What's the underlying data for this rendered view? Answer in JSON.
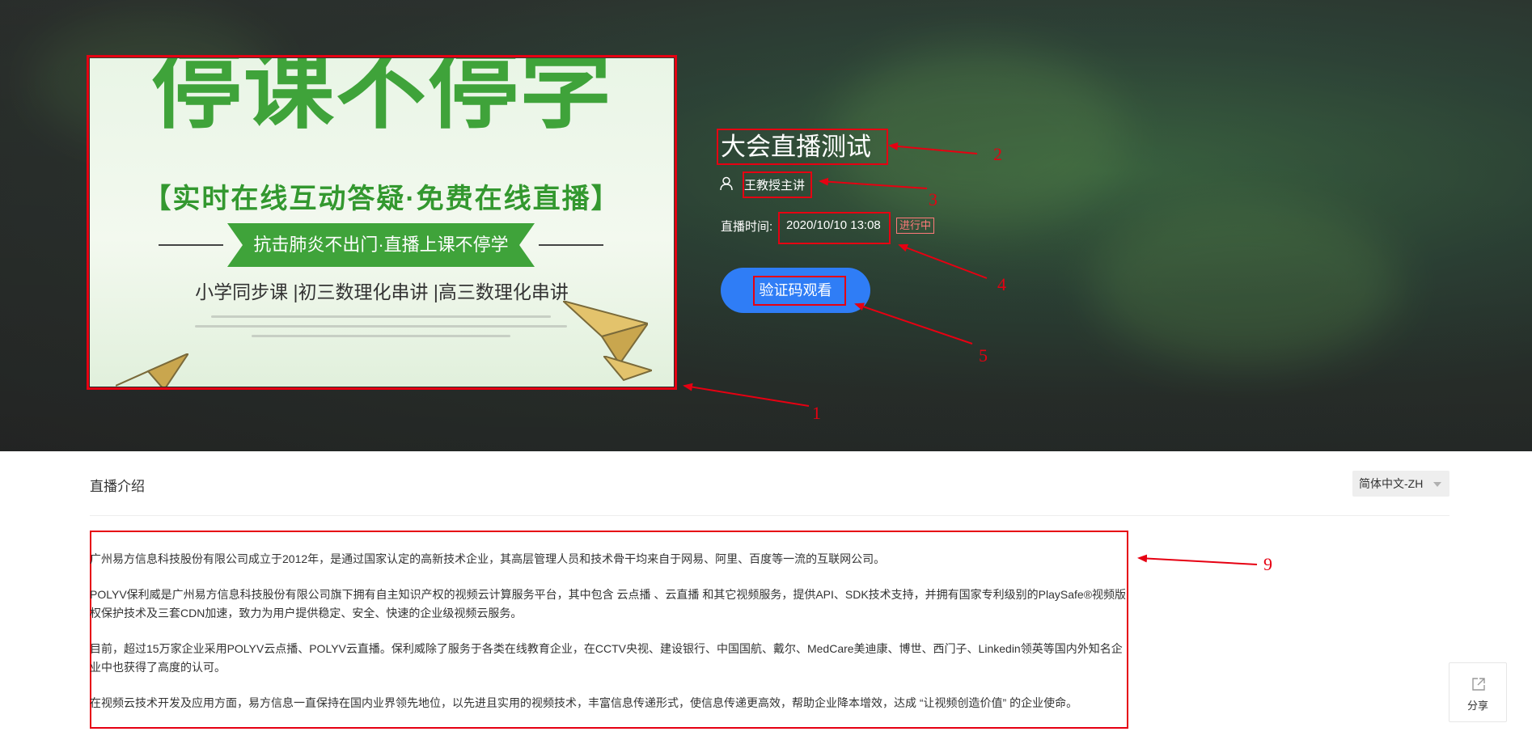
{
  "hero": {
    "cover": {
      "headline": "停课不停学",
      "subtitle": "【实时在线互动答疑·免费在线直播】",
      "ribbon": "抗击肺炎不出门·直播上课不停学",
      "courses": "小学同步课 |初三数理化串讲 |高三数理化串讲"
    },
    "title": "大会直播测试",
    "host": "王教授主讲",
    "time_label": "直播时间:",
    "time_value": "2020/10/10 13:08",
    "status": "进行中",
    "watch_button": "验证码观看",
    "icons": {
      "host": "user-icon"
    }
  },
  "intro": {
    "title": "直播介绍",
    "language_select": "简体中文-ZH",
    "paragraphs": [
      "广州易方信息科技股份有限公司成立于2012年，是通过国家认定的高新技术企业，其高层管理人员和技术骨干均来自于网易、阿里、百度等一流的互联网公司。",
      "POLYV保利威是广州易方信息科技股份有限公司旗下拥有自主知识产权的视频云计算服务平台，其中包含 云点播 、云直播 和其它视频服务，提供API、SDK技术支持，并拥有国家专利级别的PlaySafe®视频版权保护技术及三套CDN加速，致力为用户提供稳定、安全、快速的企业级视频云服务。",
      "目前，超过15万家企业采用POLYV云点播、POLYV云直播。保利威除了服务于各类在线教育企业，在CCTV央视、建设银行、中国国航、戴尔、MedCare美迪康、博世、西门子、Linkedin领英等国内外知名企业中也获得了高度的认可。",
      "在视频云技术开发及应用方面，易方信息一直保持在国内业界领先地位，以先进且实用的视频技术，丰富信息传递形式，使信息传递更高效，帮助企业降本增效，达成 “让视频创造价值” 的企业使命。"
    ]
  },
  "share": {
    "label": "分享",
    "icon": "share-icon"
  },
  "annotations": [
    "1",
    "2",
    "3",
    "4",
    "5",
    "9"
  ],
  "colors": {
    "annotation": "#e60012",
    "button": "#2f7df6",
    "status": "#ff7a7a"
  }
}
